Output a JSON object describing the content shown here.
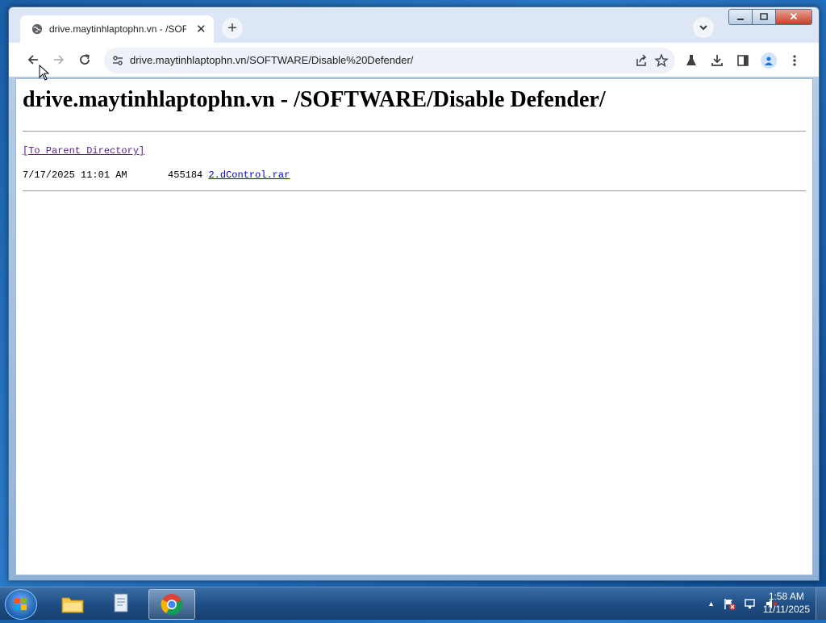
{
  "browser": {
    "tab_title": "drive.maytinhlaptophn.vn - /SOF",
    "url": "drive.maytinhlaptophn.vn/SOFTWARE/Disable%20Defender/"
  },
  "page": {
    "heading": "drive.maytinhlaptophn.vn - /SOFTWARE/Disable Defender/",
    "parent_link": "[To Parent Directory]",
    "files": [
      {
        "date": "7/17/2025 11:01 AM",
        "size": "455184",
        "name": "2.dControl.rar"
      }
    ]
  },
  "taskbar": {
    "time": "1:58 AM",
    "date": "11/11/2025",
    "icons": [
      "windows-start-icon",
      "explorer-folder-icon",
      "document-icon",
      "chrome-icon"
    ]
  },
  "colors": {
    "link": "#0000ee",
    "visited_link": "#551a8b",
    "taskbar": "#1f4f86"
  }
}
